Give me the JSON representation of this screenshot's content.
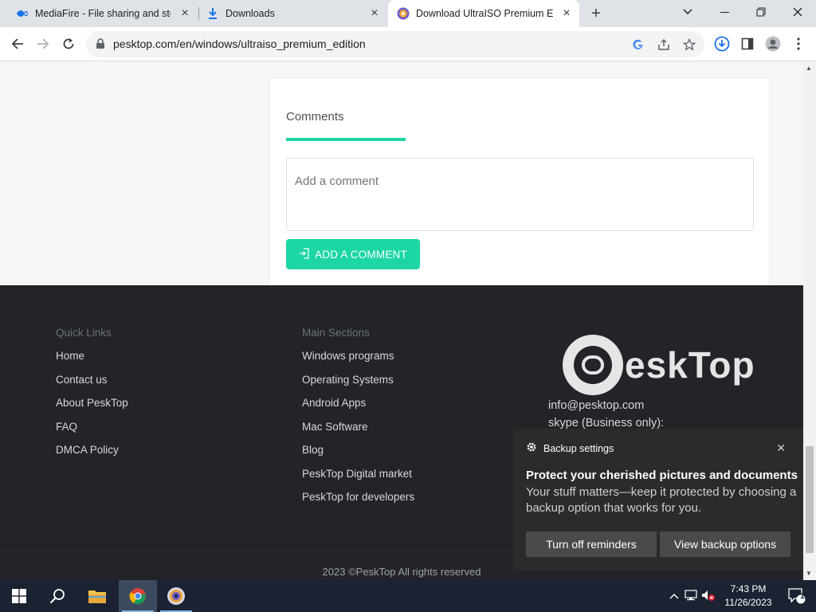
{
  "tabs": [
    {
      "title": "MediaFire - File sharing and storage",
      "icon": "mediafire-icon"
    },
    {
      "title": "Downloads",
      "icon": "download-icon"
    },
    {
      "title": "Download UltraISO Premium Edition",
      "icon": "ultraiso-icon"
    }
  ],
  "toolbar": {
    "url": "pesktop.com/en/windows/ultraiso_premium_edition"
  },
  "comments": {
    "title": "Comments",
    "placeholder": "Add a comment",
    "button_label": "ADD A COMMENT"
  },
  "footer": {
    "quick_links": {
      "title": "Quick Links",
      "items": [
        "Home",
        "Contact us",
        "About PeskTop",
        "FAQ",
        "DMCA Policy"
      ]
    },
    "main_sections": {
      "title": "Main Sections",
      "items": [
        "Windows programs",
        "Operating Systems",
        "Android Apps",
        "Mac Software",
        "Blog",
        "PeskTop Digital market",
        "PeskTop for developers"
      ]
    },
    "logo_text": "eskTop",
    "email": "info@pesktop.com",
    "skype": "skype (Business only):",
    "copyright": "2023 ©PeskTop All rights reserved"
  },
  "notification": {
    "app": "Backup settings",
    "title": "Protect your cherished pictures and documents",
    "body": "Your stuff matters—keep it protected by choosing a backup option that works for you.",
    "btn_off": "Turn off reminders",
    "btn_view": "View backup options"
  },
  "taskbar": {
    "time": "7:43 PM",
    "date": "11/26/2023",
    "notification_count": "1"
  },
  "colors": {
    "accent": "#1cd6a4",
    "footer_bg": "#222428",
    "taskbar_bg": "#1b2333"
  }
}
